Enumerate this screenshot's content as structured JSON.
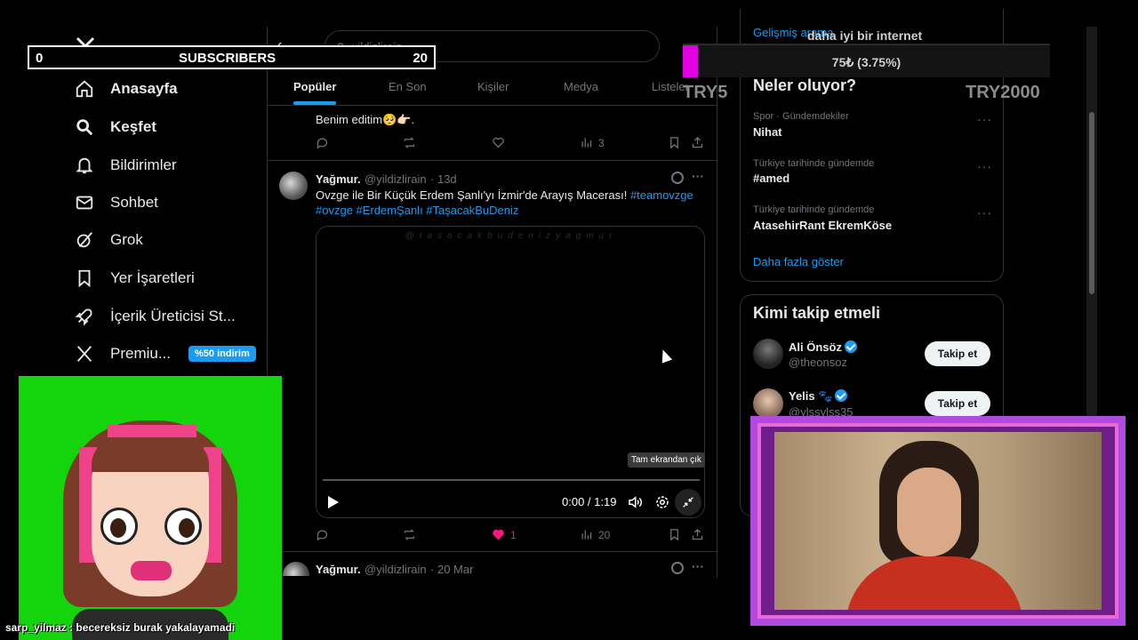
{
  "sidebar": {
    "items": [
      {
        "label": "Anasayfa",
        "icon": "home-icon"
      },
      {
        "label": "Keşfet",
        "icon": "search-icon"
      },
      {
        "label": "Bildirimler",
        "icon": "bell-icon"
      },
      {
        "label": "Sohbet",
        "icon": "mail-icon"
      },
      {
        "label": "Grok",
        "icon": "grok-icon"
      },
      {
        "label": "Yer İşaretleri",
        "icon": "bookmark-icon"
      },
      {
        "label": "İçerik Üreticisi St...",
        "icon": "rocket-icon"
      },
      {
        "label": "Premiu...",
        "icon": "x-logo-icon"
      }
    ],
    "premium_badge": "%50 indirim"
  },
  "search": {
    "value": "yildizlirain"
  },
  "tabs": [
    "Popüler",
    "En Son",
    "Kişiler",
    "Medya",
    "Listeler"
  ],
  "tweet1": {
    "text": "Benim editim🥺👉🏻.",
    "views": "3"
  },
  "tweet2": {
    "name": "Yağmur.",
    "handle": "@yildizlirain",
    "time": "· 13d",
    "text_plain": "Ovzge ile Bir Küçük Erdem Şanlı'yı İzmir'de Arayış Macerası!",
    "tags_line1": "#teamovzge",
    "tags_line2": "#ovzge #ErdemŞanlı #TaşacakBuDeniz",
    "watermark": "@tasacakbudenizyagmur",
    "video_time": "0:00 / 1:19",
    "tooltip": "Tam ekrandan çık",
    "likes": "1",
    "views": "20"
  },
  "tweet3": {
    "name": "Yağmur.",
    "handle": "@yildizlirain",
    "time": "· 20 Mar"
  },
  "right": {
    "advanced_link": "Gelişmiş arama",
    "trends_title": "Neler oluyor?",
    "trends": [
      {
        "meta": "Spor · Gündemdekiler",
        "topic": "Nihat"
      },
      {
        "meta": "Türkiye tarihinde gündemde",
        "topic": "#amed"
      },
      {
        "meta": "Türkiye tarihinde gündemde",
        "topic": "AtasehirRant EkremKöse"
      }
    ],
    "show_more": "Daha fazla göster",
    "follow_title": "Kimi takip etmeli",
    "follow": [
      {
        "name": "Ali Önsöz",
        "handle": "@theonsoz",
        "button": "Takip et"
      },
      {
        "name": "Yelis 🐾",
        "handle": "@ylssylss35",
        "button": "Takip et"
      }
    ]
  },
  "overlay": {
    "subs_left": "0",
    "subs_label": "SUBSCRIBERS",
    "subs_right": "20",
    "goal_title": "daha iyi bir internet",
    "goal_text": "75₺ (3.75%)",
    "goal_progress_percent": 3.75,
    "goal_min": "TRY5",
    "goal_max": "TRY2000",
    "chat_message": "sarp_yilmaz : becereksiz burak yakalayamadi"
  },
  "colors": {
    "accent": "#1d9bf0",
    "goal_fill": "#e000e0",
    "avatar_bg": "#14d40c",
    "like_pink": "#f91880"
  }
}
